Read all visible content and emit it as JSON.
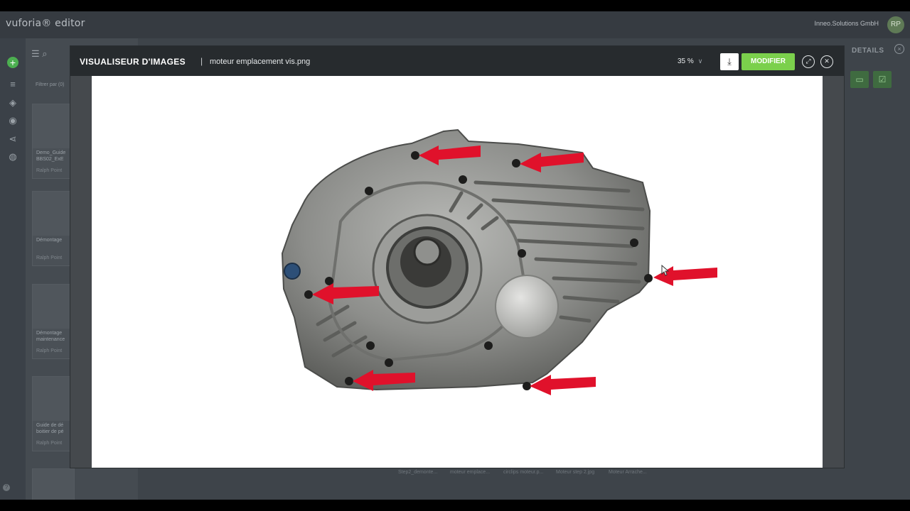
{
  "app": {
    "logo": "vuforia® editor",
    "org": "Inneo.Solutions GmbH",
    "avatar": "RP"
  },
  "sidebar": {
    "filter_label": "Filtrer par (0)",
    "cards": [
      {
        "title": "Demo_Guide BBS02_ExE",
        "author": "Ralph Point"
      },
      {
        "title": "Démontage",
        "author": "Ralph Point"
      },
      {
        "title": "Démontage maintenance",
        "author": "Ralph Point"
      },
      {
        "title": "Guide de dé boitier de pé",
        "author": "Ralph Point"
      }
    ]
  },
  "details": {
    "label": "DETAILS"
  },
  "bottom_files": [
    "Step2_demonte...",
    "moteur emplace...",
    "circlips moteur.p...",
    "Moteur step 2.jpg",
    "Moteur Arrache..."
  ],
  "viewer": {
    "title": "VISUALISEUR D'IMAGES",
    "separator": "|",
    "filename": "moteur emplacement vis.png",
    "zoom": "35 %",
    "modify_label": "MODIFIER",
    "icons": {
      "download": "download-icon",
      "expand": "expand-icon",
      "close": "close-icon"
    }
  },
  "colors": {
    "accent_green": "#7bd04c",
    "arrow_red": "#e0112b",
    "header_dark": "#272b2e"
  }
}
